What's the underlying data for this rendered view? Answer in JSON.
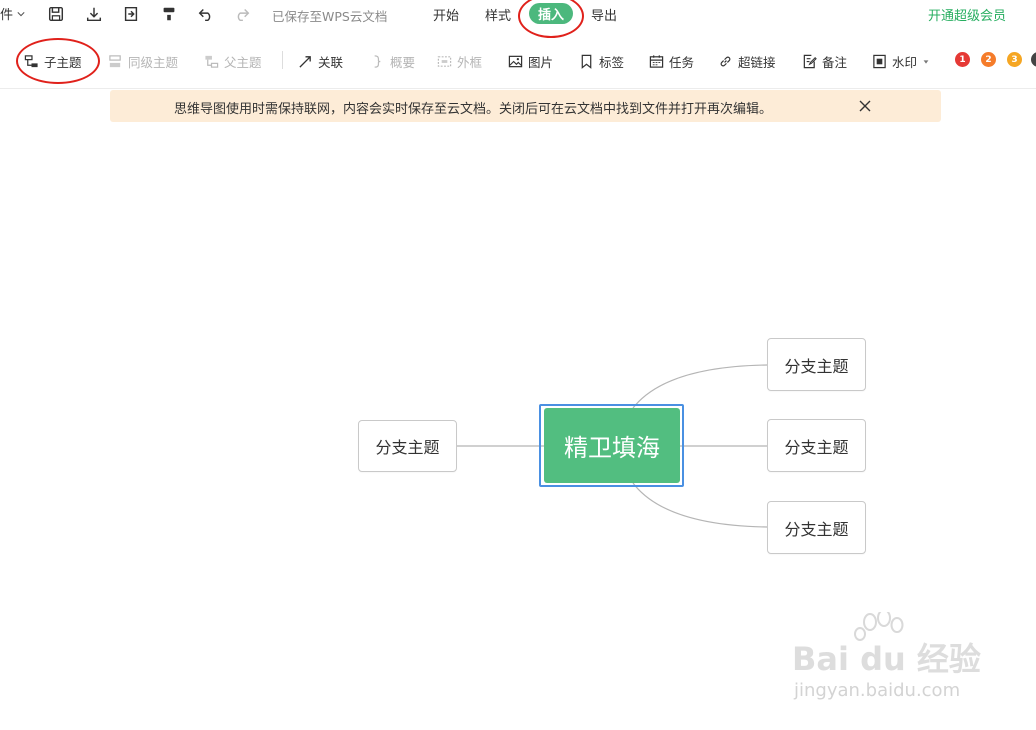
{
  "topbar": {
    "file_label": "件",
    "saved_status": "已保存至WPS云文档",
    "tabs": [
      {
        "label": "开始"
      },
      {
        "label": "样式"
      },
      {
        "label": "插入",
        "active": true
      },
      {
        "label": "导出"
      }
    ],
    "vip_label": "开通超级会员",
    "accent_color": "#4cb87d"
  },
  "toolbar": {
    "items": [
      {
        "label": "子主题",
        "icon": "child-topic-icon",
        "enabled": true
      },
      {
        "label": "同级主题",
        "icon": "sibling-topic-icon",
        "enabled": false
      },
      {
        "label": "父主题",
        "icon": "parent-topic-icon",
        "enabled": false
      },
      {
        "label": "关联",
        "icon": "relation-arrow-icon",
        "enabled": true
      },
      {
        "label": "概要",
        "icon": "summary-brace-icon",
        "enabled": false
      },
      {
        "label": "外框",
        "icon": "boundary-icon",
        "enabled": false
      },
      {
        "label": "图片",
        "icon": "image-icon",
        "enabled": true
      },
      {
        "label": "标签",
        "icon": "bookmark-icon",
        "enabled": true
      },
      {
        "label": "任务",
        "icon": "calendar-icon",
        "enabled": true
      },
      {
        "label": "超链接",
        "icon": "link-icon",
        "enabled": true
      },
      {
        "label": "备注",
        "icon": "note-icon",
        "enabled": true
      },
      {
        "label": "水印",
        "icon": "watermark-icon",
        "enabled": true
      }
    ],
    "priority_badges": [
      {
        "label": "1",
        "color": "#e53935"
      },
      {
        "label": "2",
        "color": "#f57c2a"
      },
      {
        "label": "3",
        "color": "#f5a623"
      }
    ]
  },
  "notice": {
    "text": "思维导图使用时需保持联网，内容会实时保存至云文档。关闭后可在云文档中找到文件并打开再次编辑。"
  },
  "mindmap": {
    "central_topic": "精卫填海",
    "central_color": "#52be80",
    "left_branches": [
      {
        "label": "分支主题"
      }
    ],
    "right_branches": [
      {
        "label": "分支主题"
      },
      {
        "label": "分支主题"
      },
      {
        "label": "分支主题"
      }
    ]
  },
  "watermark": {
    "brand": "Bai du 经验",
    "url": "jingyan.baidu.com"
  }
}
